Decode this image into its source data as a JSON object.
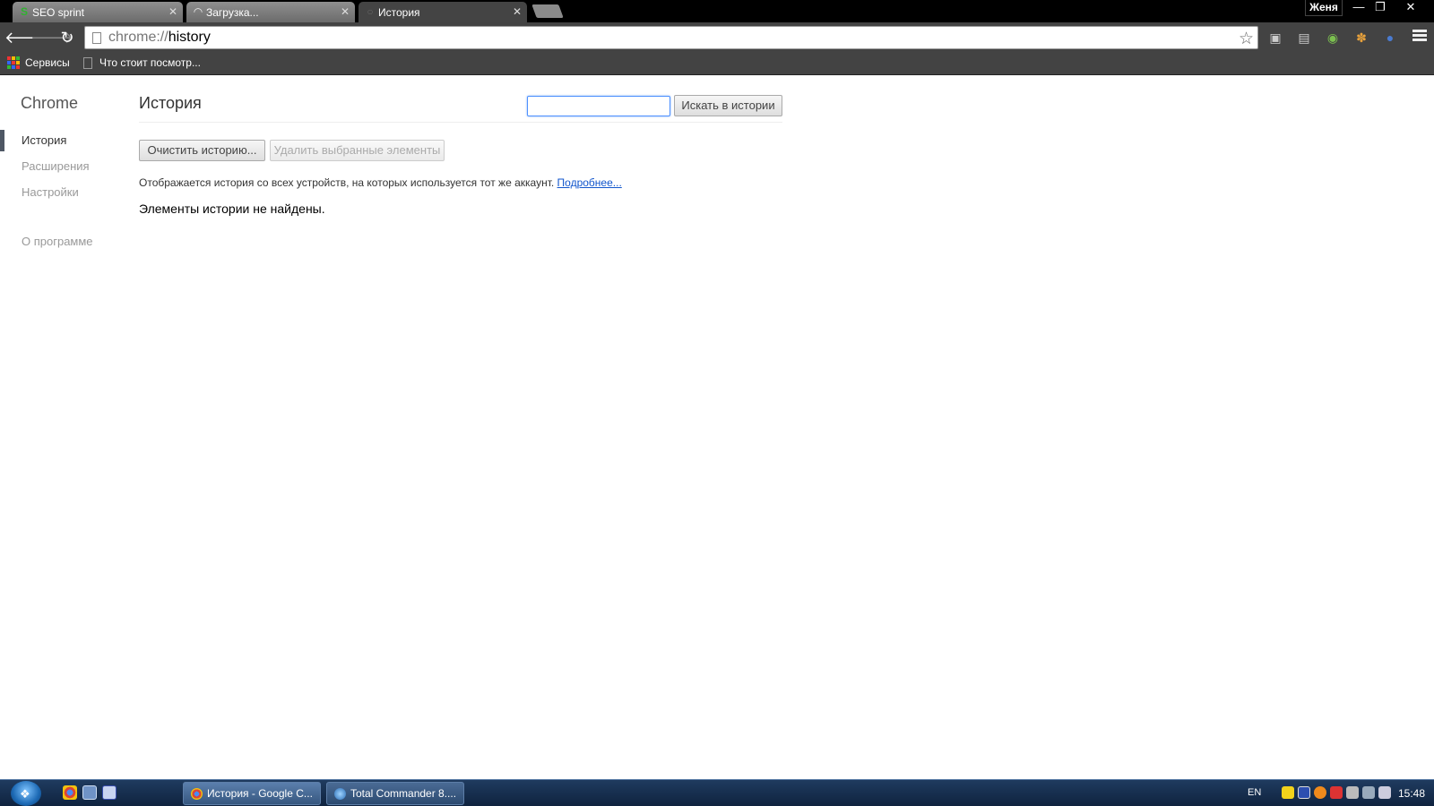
{
  "browser": {
    "tabs": [
      {
        "title": "SEO sprint",
        "icon": "seo-sprint-favicon"
      },
      {
        "title": "Загрузка...",
        "icon": "loading-spinner-icon"
      },
      {
        "title": "История",
        "icon": "history-page-icon"
      }
    ],
    "user": "Женя",
    "window_controls": {
      "minimize": "—",
      "restore": "❐",
      "close": "✕"
    },
    "address": {
      "scheme": "chrome://",
      "path": "history"
    },
    "bookmarks": [
      {
        "label": "Сервисы",
        "icon": "apps-grid-icon"
      },
      {
        "label": "Что стоит посмотр...",
        "icon": "page-icon"
      }
    ]
  },
  "sidebar": {
    "title": "Chrome",
    "items": [
      "История",
      "Расширения",
      "Настройки"
    ],
    "about": "О программе"
  },
  "main": {
    "title": "История",
    "search_value": "",
    "search_button": "Искать в истории",
    "clear_button": "Очистить историю...",
    "remove_button": "Удалить выбранные элементы",
    "info_text": "Отображается история со всех устройств, на которых используется тот же аккаунт.",
    "info_link": "Подробнее...",
    "empty_message": "Элементы истории не найдены."
  },
  "taskbar": {
    "items": [
      {
        "label": "История - Google C...",
        "icon": "chrome-icon"
      },
      {
        "label": "Total Commander 8....",
        "icon": "total-commander-icon"
      }
    ],
    "language": "EN",
    "time": "15:48"
  }
}
